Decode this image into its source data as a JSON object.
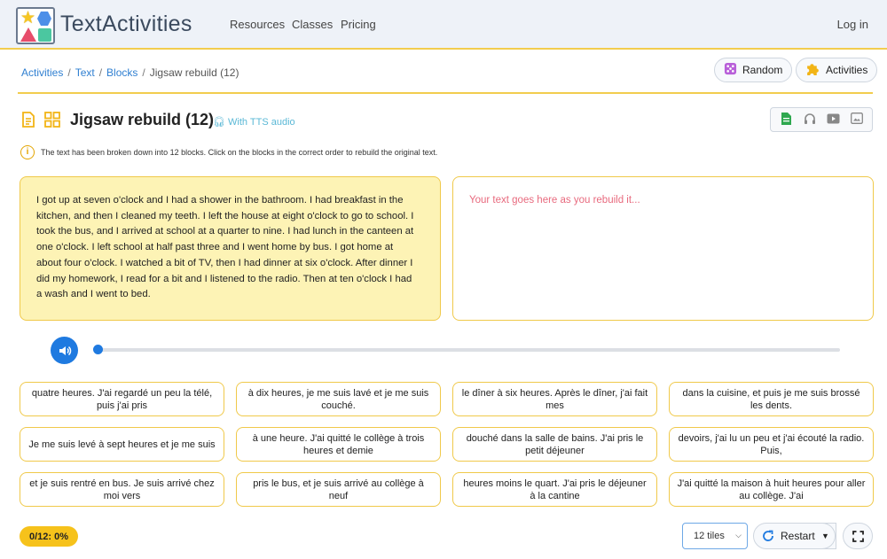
{
  "header": {
    "brand": "TextActivities",
    "nav": [
      "Resources",
      "Classes",
      "Pricing"
    ],
    "login": "Log in"
  },
  "breadcrumb": {
    "items": [
      "Activities",
      "Text",
      "Blocks"
    ],
    "current": "Jigsaw rebuild (12)"
  },
  "actions": {
    "random": "Random",
    "activities": "Activities"
  },
  "title": {
    "text": "Jigsaw rebuild (12)",
    "tts": "With TTS audio"
  },
  "info": "The text has been broken down into 12 blocks. Click on the blocks in the correct order to rebuild the original text.",
  "source_text": "I got up at seven o'clock and I had a shower in the bathroom. I had breakfast in the kitchen, and then I cleaned my teeth. I left the house at eight o'clock to go to school. I took the bus, and I arrived at school at a quarter to nine. I had lunch in the canteen at one o'clock. I left school at half past three and I went home by bus. I got home at about four o'clock. I watched a bit of TV, then I had dinner at six o'clock. After dinner I did my homework, I read for a bit and I listened to the radio. Then at ten o'clock I had a wash and I went to bed.",
  "rebuild_placeholder": "Your text goes here as you rebuild it...",
  "audio": {
    "progress": 0
  },
  "tiles": [
    "quatre heures. J'ai regardé un peu la télé, puis j'ai pris",
    "à dix heures, je me suis lavé et je me suis couché.",
    "le dîner à six heures. Après le dîner, j'ai fait mes",
    "dans la cuisine, et puis je me suis brossé les dents.",
    "Je me suis levé à sept heures et je me suis",
    "à une heure. J'ai quitté le collège à trois heures et demie",
    "douché dans la salle de bains. J'ai pris le petit déjeuner",
    "devoirs, j'ai lu un peu et j'ai écouté la radio. Puis,",
    "et je suis rentré en bus. Je suis arrivé chez moi vers",
    "pris le bus, et je suis arrivé au collège à neuf",
    "heures moins le quart. J'ai pris le déjeuner à la cantine",
    "J'ai quitté la maison à huit heures pour aller au collège. J'ai"
  ],
  "footer": {
    "progress": "0/12: 0%",
    "tiles_select": "12 tiles",
    "restart": "Restart"
  },
  "colors": {
    "accent": "#f2cd4e",
    "link": "#2f7fd1",
    "audio": "#1f7ae0",
    "placeholder": "#e86a7e"
  }
}
